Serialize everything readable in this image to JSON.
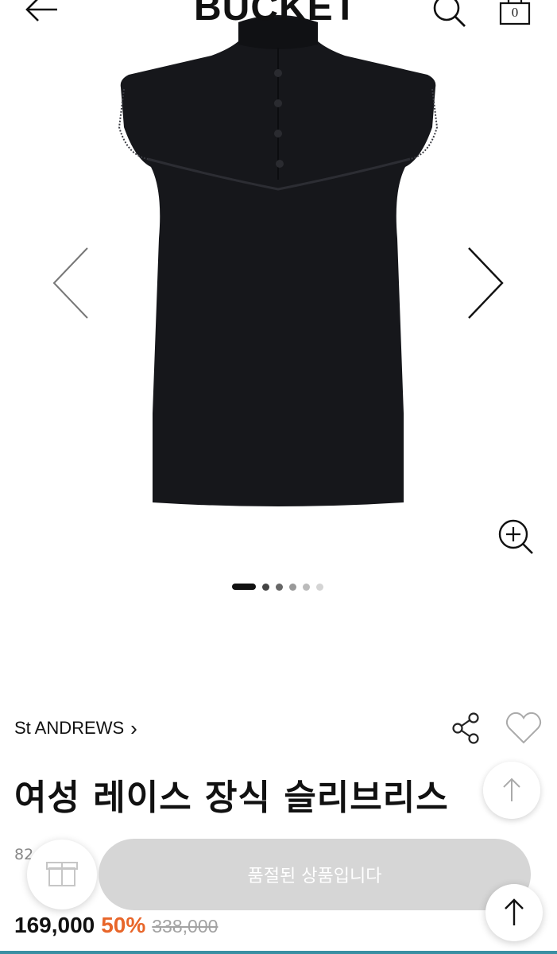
{
  "header": {
    "logo": "BUCKET",
    "cart_count": "0",
    "icons": {
      "back": "arrow-left-icon",
      "search": "search-icon",
      "cart": "shopping-bag-icon"
    }
  },
  "gallery": {
    "image_desc": "product-image",
    "slides_total": 6,
    "active_slide": 1,
    "icons": {
      "prev": "chevron-left-icon",
      "next": "chevron-right-icon",
      "zoom": "zoom-in-icon"
    }
  },
  "product": {
    "brand": "St ANDREWS",
    "brand_chevron": "›",
    "title": "여성 레이스 장식 슬리브리스",
    "code_partial": "82          0",
    "price": "169,000",
    "discount": "50%",
    "original_price": "338,000"
  },
  "actions": {
    "soldout_label": "품절된 상품입니다",
    "icons": {
      "share": "share-icon",
      "like": "heart-icon",
      "gift": "gift-icon",
      "scroll_top": "arrow-up-icon"
    }
  },
  "colors": {
    "discount": "#e8662a",
    "soldout_bg": "#d6d6d6",
    "original_price": "#a3a3a3",
    "accent_bar": "#3a8fa3"
  }
}
